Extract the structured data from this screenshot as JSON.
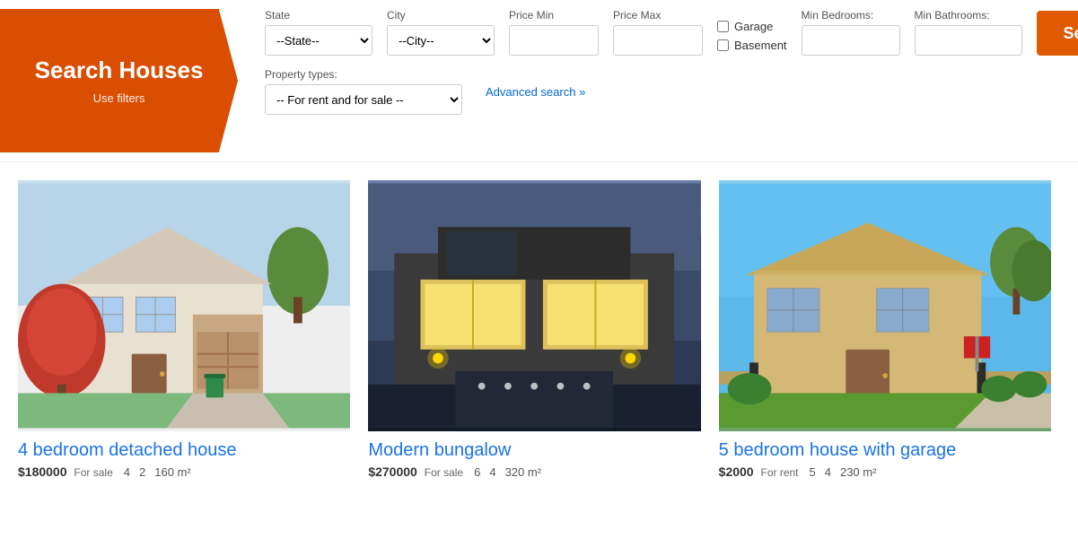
{
  "banner": {
    "title": "Search Houses",
    "subtitle": "Use filters"
  },
  "filters": {
    "state_label": "State",
    "state_placeholder": "--State--",
    "city_label": "City",
    "city_placeholder": "--City--",
    "price_min_label": "Price Min",
    "price_max_label": "Price Max",
    "min_bedrooms_label": "Min Bedrooms:",
    "min_bathrooms_label": "Min Bathrooms:",
    "garage_label": "Garage",
    "basement_label": "Basement",
    "property_type_label": "Property types:",
    "property_type_placeholder": "-- For rent and for sale --",
    "search_button": "Search",
    "advanced_search": "Advanced search »"
  },
  "listings": [
    {
      "title": "4 bedroom detached house",
      "price": "$180000",
      "sale_type": "For sale",
      "bedrooms": "4",
      "bathrooms": "2",
      "area": "160 m²"
    },
    {
      "title": "Modern bungalow",
      "price": "$270000",
      "sale_type": "For sale",
      "bedrooms": "6",
      "bathrooms": "4",
      "area": "320 m²"
    },
    {
      "title": "5 bedroom house with garage",
      "price": "$2000",
      "sale_type": "For rent",
      "bedrooms": "5",
      "bathrooms": "4",
      "area": "230 m²"
    }
  ]
}
